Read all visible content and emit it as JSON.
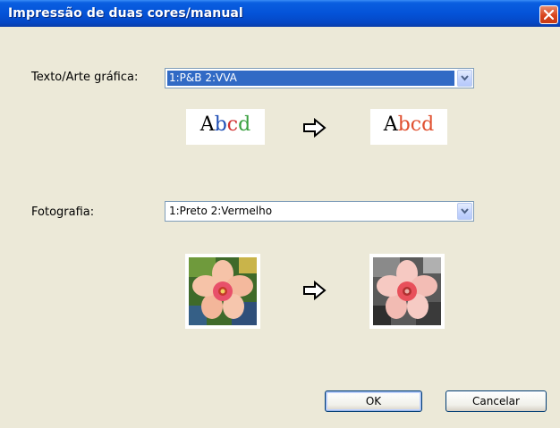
{
  "window": {
    "title": "Impressão de duas cores/manual"
  },
  "text_art": {
    "label": "Texto/Arte gráfica:",
    "selected": "1:P&B 2:VVA",
    "sample_before": [
      "A",
      "b",
      "c",
      "d"
    ],
    "sample_after": [
      "A",
      "b",
      "c",
      "d"
    ]
  },
  "photo": {
    "label": "Fotografia:",
    "selected": "1:Preto 2:Vermelho"
  },
  "buttons": {
    "ok": "OK",
    "cancel": "Cancelar"
  },
  "colors": {
    "title_bar": "#0453d8",
    "dialog_bg": "#ece9d8",
    "selection": "#316ac5",
    "sample_before": [
      "#000000",
      "#1f4fb5",
      "#d03030",
      "#3aa040"
    ],
    "sample_after": [
      "#000000",
      "#e05030",
      "#e05030",
      "#e05030"
    ]
  },
  "icons": [
    "close-icon",
    "chevron-down-icon",
    "right-arrow-icon"
  ]
}
